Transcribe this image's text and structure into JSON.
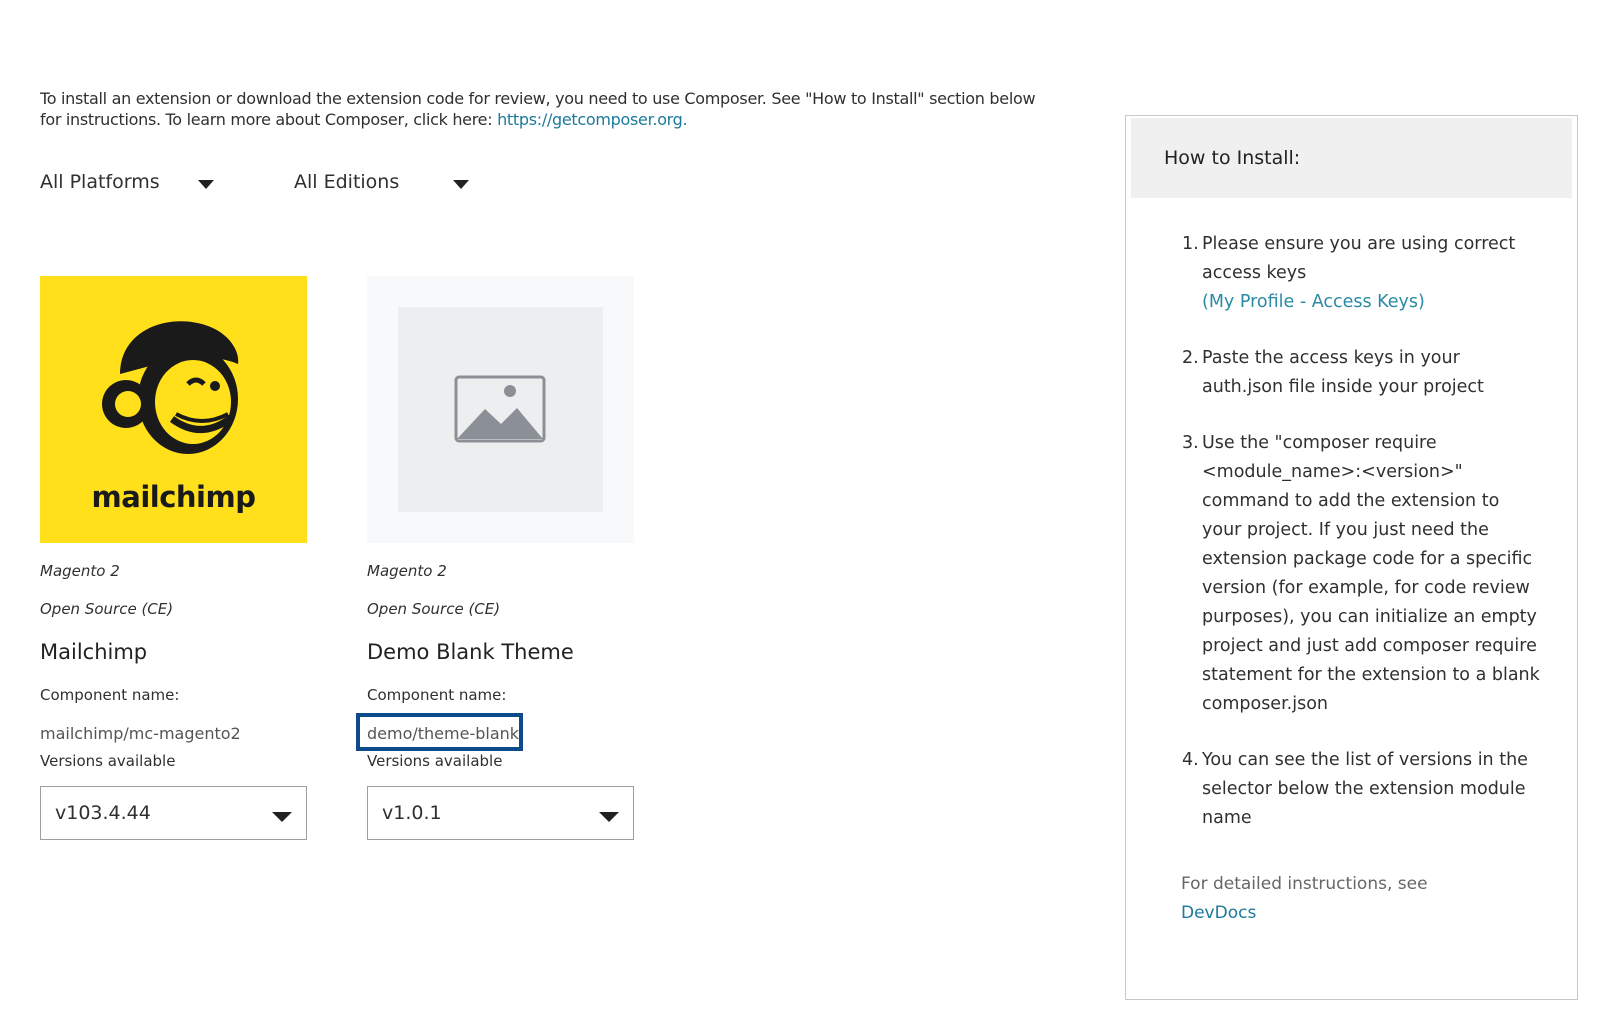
{
  "intro": {
    "text": "To install an extension or download the extension code for review, you need to use Composer. See \"How to Install\" section below for instructions. To learn more about Composer, click here: ",
    "link": "https://getcomposer.org."
  },
  "filters": {
    "platforms": "All Platforms",
    "editions": "All Editions"
  },
  "cards": [
    {
      "brand_word": "mailchimp",
      "platform": "Magento 2",
      "edition": "Open Source (CE)",
      "title": "Mailchimp",
      "component_label": "Component name:",
      "component_value": "mailchimp/mc-magento2",
      "versions_label": "Versions available",
      "version": "v103.4.44"
    },
    {
      "platform": "Magento 2",
      "edition": "Open Source (CE)",
      "title": "Demo Blank Theme",
      "component_label": "Component name:",
      "component_value": "demo/theme-blank",
      "versions_label": "Versions available",
      "version": "v1.0.1"
    }
  ],
  "panel": {
    "title": "How to Install:",
    "steps": [
      {
        "num": "1.",
        "text": "Please ensure you are using correct access keys",
        "link": "(My Profile - Access Keys)"
      },
      {
        "num": "2.",
        "text": "Paste the access keys in your auth.json file inside your project"
      },
      {
        "num": "3.",
        "text": "Use the \"composer require <module_name>:<version>\" command to add the extension to your project. If you just need the extension package code for a specific version (for example, for code review purposes), you can initialize an empty project and just add composer require statement for the extension to a blank composer.json"
      },
      {
        "num": "4.",
        "text": "You can see the list of versions in the selector below the extension module name"
      }
    ],
    "footer_text": "For detailed instructions, see",
    "footer_link": "DevDocs"
  },
  "colors": {
    "mailchimp_yellow": "#ffe01b",
    "link": "#1b7a9a",
    "highlight_border": "#0d4a8c"
  }
}
